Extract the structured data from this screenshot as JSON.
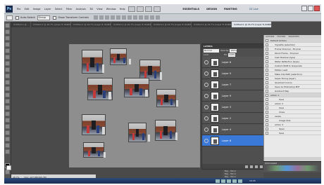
{
  "app": {
    "logo": "Ps",
    "workspaces": [
      "ESSENTIALS",
      "DESIGN",
      "PAINTING"
    ],
    "cs_live": "CS Live"
  },
  "menu": [
    "File",
    "Edit",
    "Image",
    "Layer",
    "Select",
    "Filter",
    "Analysis",
    "3D",
    "View",
    "Window",
    "Help"
  ],
  "options_bar": {
    "auto_select_label": "Auto-Select:",
    "auto_select_value": "Group",
    "show_transform": "Show Transform Controls"
  },
  "tabs": [
    "Untitled-1 @ ...",
    "Untitled-1 @ 16.7% (Layer 8, RGB/8)",
    "Untitled-1 @ 16.7% (Layer 8, RGB/8)",
    "Untitled-1 @ 16.7% (Layer 8, RGB/8)",
    "Untitled-1 @ 16.7% (Layer 8, RGB/8)",
    "Untitled-1 @ 16.7% (Layer 8, RGB/8)",
    "Untitled-1 @ 16.7% (Layer 8, RGB/8)"
  ],
  "status": {
    "zoom": "16.7%",
    "doc": "Doc: 107.6M/105.3M"
  },
  "layers": {
    "title": "LAYERS",
    "blend": "Normal",
    "opacity_label": "Opacity:",
    "opacity": "100%",
    "fill_label": "Fill:",
    "fill": "100%",
    "lock_label": "Lock:",
    "items": [
      "Layer 6",
      "Layer 5",
      "Layer 7",
      "Layer 9",
      "Layer 3",
      "Layer 2",
      "Layer 4",
      "Layer 8"
    ],
    "selected_index": 7
  },
  "layers_lower": [
    "Bkg - Mirror",
    "Bkg - Mirror",
    "Bkg - Mirror",
    "Bkg - Mirror",
    "Bkg - Mirror"
  ],
  "actions": {
    "tabs": [
      "ACTIONS",
      "HISTORY",
      "SWATCHES"
    ],
    "items": [
      {
        "label": "Default Actions",
        "level": 0,
        "head": true
      },
      {
        "label": "Vignette (selection)",
        "level": 1
      },
      {
        "label": "Frame Channel - 50 pixel",
        "level": 1
      },
      {
        "label": "Wood Frame - 50 pixel",
        "level": 1
      },
      {
        "label": "Cast Shadow (type)",
        "level": 1
      },
      {
        "label": "Water Reflection (type)",
        "level": 1
      },
      {
        "label": "Custom RGB to Grayscale",
        "level": 1
      },
      {
        "label": "Molten Lead",
        "level": 1
      },
      {
        "label": "Make Clip Path (selection)",
        "level": 1
      },
      {
        "label": "Sepia Toning (layer)",
        "level": 1
      },
      {
        "label": "Quadrant Colors",
        "level": 1
      },
      {
        "label": "Save As Photoshop PDF",
        "level": 1
      },
      {
        "label": "Gradient Map",
        "level": 1
      },
      {
        "label": "action 1",
        "level": 0,
        "head": true
      },
      {
        "label": "Save",
        "level": 2
      },
      {
        "label": "action 2",
        "level": 1
      },
      {
        "label": "Save",
        "level": 2
      },
      {
        "label": "Close",
        "level": 2
      },
      {
        "label": "resize",
        "level": 1
      },
      {
        "label": "Image Size",
        "level": 2
      },
      {
        "label": "action 3",
        "level": 1
      },
      {
        "label": "Open",
        "level": 2
      },
      {
        "label": "Save",
        "level": 2
      }
    ]
  },
  "histogram": {
    "label": "HISTOGRAM"
  },
  "taskbar": {
    "clock": "10:25"
  },
  "colors": {
    "accent": "#3b79d9",
    "canvas": "#8e8e8e",
    "chrome": "#4a4a4a"
  }
}
